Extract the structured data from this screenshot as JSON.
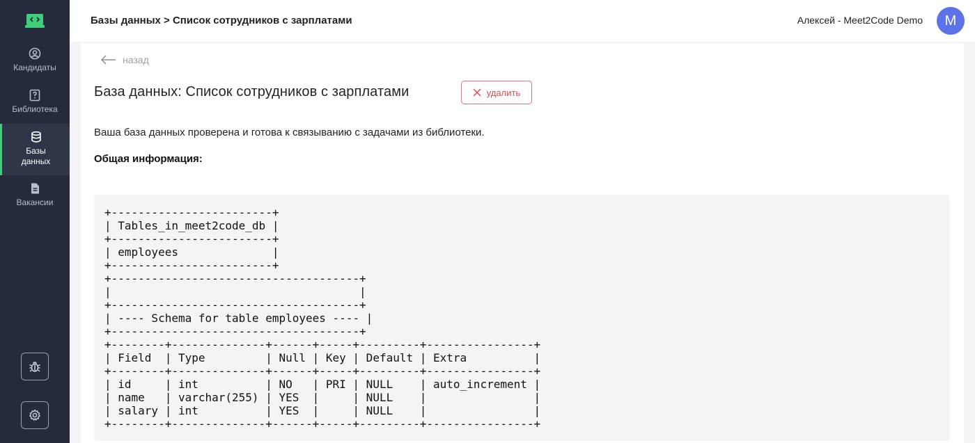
{
  "sidebar": {
    "items": [
      {
        "label": "Кандидаты",
        "icon": "user-circle-icon"
      },
      {
        "label": "Библиотека",
        "icon": "question-book-icon"
      },
      {
        "label": "Базы данных",
        "icon": "database-icon"
      },
      {
        "label": "Вакансии",
        "icon": "document-icon"
      }
    ],
    "bottom_buttons": [
      {
        "icon": "bug-icon"
      },
      {
        "icon": "gear-icon"
      }
    ],
    "accent_color": "#3fcf7a"
  },
  "header": {
    "breadcrumb": "Базы данных > Список сотрудников с зарплатами",
    "user_name": "Алексей - Meet2Code Demo",
    "avatar_letter": "M",
    "avatar_color": "#5b72e8"
  },
  "main": {
    "back_label": "назад",
    "title": "База данных: Список сотрудников с зарплатами",
    "delete_label": "удалить",
    "status_text": "Ваша база данных проверена и готова к связыванию с задачами из библиотеки.",
    "section_label": "Общая информация:",
    "schema_text": "+------------------------+\n| Tables_in_meet2code_db |\n+------------------------+\n| employees              |\n+------------------------+\n+-------------------------------------+\n|                                     |\n+-------------------------------------+\n| ---- Schema for table employees ---- |\n+-------------------------------------+\n+--------+--------------+------+-----+---------+----------------+\n| Field  | Type         | Null | Key | Default | Extra          |\n+--------+--------------+------+-----+---------+----------------+\n| id     | int          | NO   | PRI | NULL    | auto_increment |\n| name   | varchar(255) | YES  |     | NULL    |                |\n| salary | int          | YES  |     | NULL    |                |\n+--------+--------------+------+-----+---------+----------------+"
  }
}
